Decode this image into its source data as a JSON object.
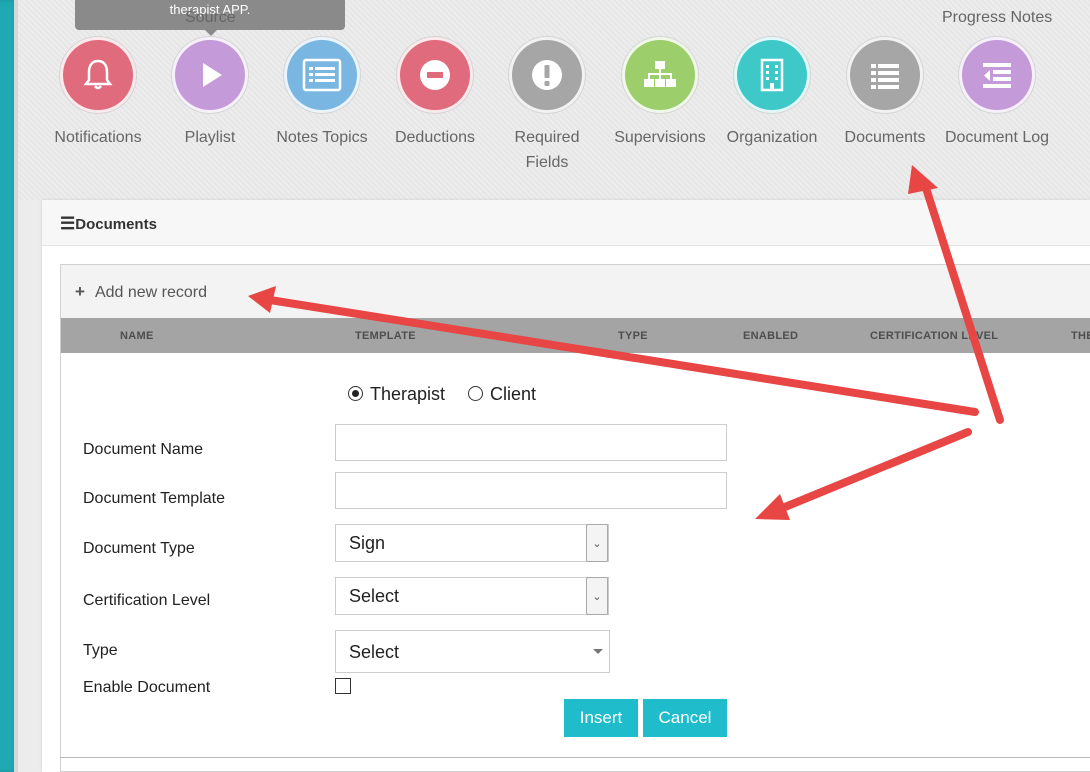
{
  "tooltip": {
    "text": "therapist APP.",
    "sub_label": "Source"
  },
  "top_right_label": "Progress Notes",
  "icons": [
    {
      "label": "Notifications",
      "color": "#e06b7d",
      "icon": "bell-icon"
    },
    {
      "label": "Playlist",
      "color": "#c49ad9",
      "icon": "play-icon"
    },
    {
      "label": "Notes Topics",
      "color": "#7ab6e2",
      "icon": "list-icon"
    },
    {
      "label": "Deductions",
      "color": "#e06b7d",
      "icon": "minus-circle-icon"
    },
    {
      "label": "Required Fields",
      "color": "#a6a6a6",
      "icon": "exclamation-icon"
    },
    {
      "label": "Supervisions",
      "color": "#9ccf6b",
      "icon": "sitemap-icon"
    },
    {
      "label": "Organization",
      "color": "#3ec8c8",
      "icon": "building-icon"
    },
    {
      "label": "Documents",
      "color": "#a6a6a6",
      "icon": "list-icon"
    },
    {
      "label": "Document Log",
      "color": "#c49ad9",
      "icon": "outdent-icon"
    }
  ],
  "panel": {
    "title": "Documents"
  },
  "grid": {
    "add_record": "Add new record",
    "columns": [
      "NAME",
      "TEMPLATE",
      "TYPE",
      "ENABLED",
      "CERTIFICATION LEVEL",
      "THE"
    ]
  },
  "form": {
    "radio_options": [
      "Therapist",
      "Client"
    ],
    "selected_radio": "Therapist",
    "document_name_label": "Document Name",
    "document_name_value": "",
    "document_template_label": "Document Template",
    "document_template_value": "",
    "document_type_label": "Document Type",
    "document_type_value": "Sign",
    "certification_level_label": "Certification Level",
    "certification_level_value": "Select",
    "type_label": "Type",
    "type_value": "Select",
    "enable_document_label": "Enable Document",
    "enable_document_checked": false,
    "insert_label": "Insert",
    "cancel_label": "Cancel"
  },
  "colors": {
    "accent": "#1fbccb",
    "sidebar": "#1fa9b3",
    "arrow": "#e84545"
  }
}
